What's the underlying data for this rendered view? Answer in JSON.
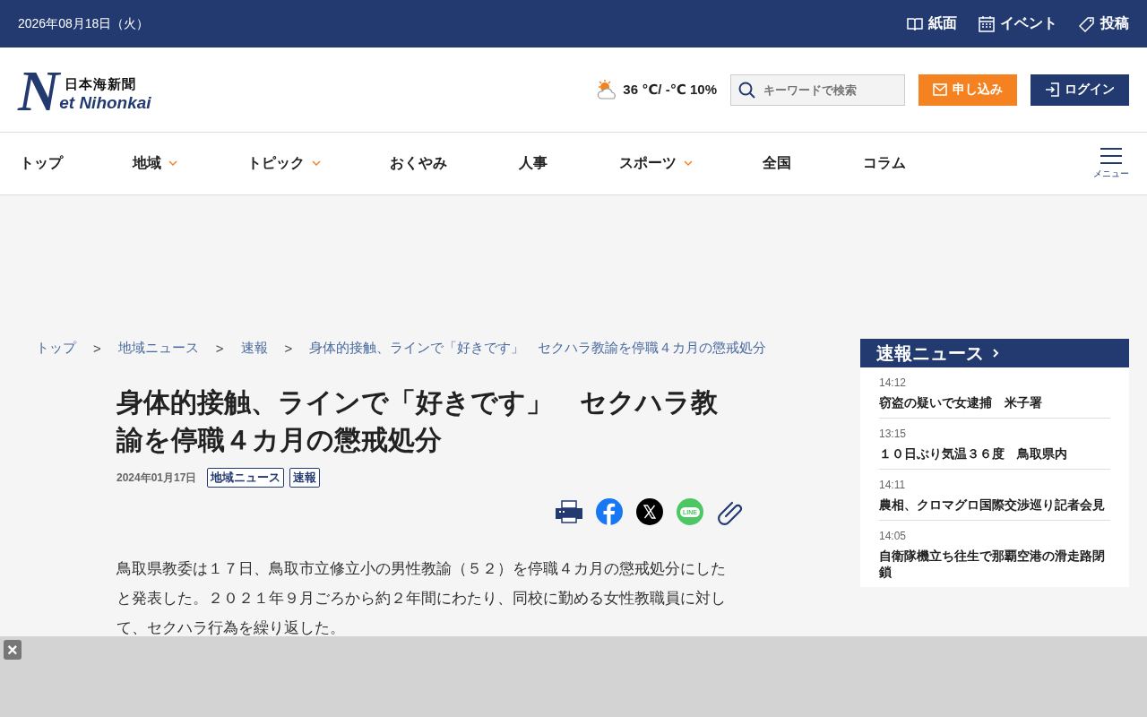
{
  "topbar": {
    "date": "2026年08月18日（火）",
    "links": [
      {
        "kind": "book",
        "label": "紙面"
      },
      {
        "kind": "calendar",
        "label": "イベント"
      },
      {
        "kind": "pen",
        "label": "投稿"
      }
    ]
  },
  "header": {
    "logo": {
      "initial": "N",
      "rest": "et Nihonkai",
      "name": "日本海新聞"
    },
    "weather": "36 ℃/ -℃ 10%",
    "search": {
      "placeholder": "キーワードで検索"
    },
    "subscribe": "申し込み",
    "login": "ログイン"
  },
  "nav": {
    "items": [
      {
        "label": "トップ",
        "dropdown": false
      },
      {
        "label": "地域",
        "dropdown": true
      },
      {
        "label": "トピック",
        "dropdown": true
      },
      {
        "label": "おくやみ",
        "dropdown": false
      },
      {
        "label": "人事",
        "dropdown": false
      },
      {
        "label": "スポーツ",
        "dropdown": true
      },
      {
        "label": "全国",
        "dropdown": false
      },
      {
        "label": "コラム",
        "dropdown": false
      }
    ],
    "menu_label": "メニュー"
  },
  "breadcrumb": [
    "トップ",
    "地域ニュース",
    "速報",
    "身体的接触、ラインで「好きです」　セクハラ教諭を停職４カ月の懲戒処分"
  ],
  "breadcrumb_separator": ">",
  "article": {
    "title": "身体的接触、ラインで「好きです」　セクハラ教諭を停職４カ月の懲戒処分",
    "date": "2024年01月17日",
    "tags": [
      "地域ニュース",
      "速報"
    ],
    "share": [
      {
        "kind": "print"
      },
      {
        "kind": "facebook"
      },
      {
        "kind": "x"
      },
      {
        "kind": "line",
        "label": "LINE"
      },
      {
        "kind": "clip"
      }
    ],
    "body": "鳥取県教委は１７日、鳥取市立修立小の男性教諭（５２）を停職４カ月の懲戒処分にしたと発表した。２０２１年９月ごろから約２年間にわたり、同校に勤める女性教職員に対して、セクハラ行為を繰り返した。"
  },
  "sidebar": {
    "title": "速報ニュース",
    "items": [
      {
        "time": "14:12",
        "headline": "窃盗の疑いで女逮捕　米子署"
      },
      {
        "time": "13:15",
        "headline": "１０日ぶり気温３６度　鳥取県内"
      },
      {
        "time": "14:11",
        "headline": "農相、クロマグロ国際交渉巡り記者会見"
      },
      {
        "time": "14:05",
        "headline": "自衛隊機立ち往生で那覇空港の滑走路閉鎖"
      }
    ]
  },
  "overlay": {
    "close": "×"
  }
}
